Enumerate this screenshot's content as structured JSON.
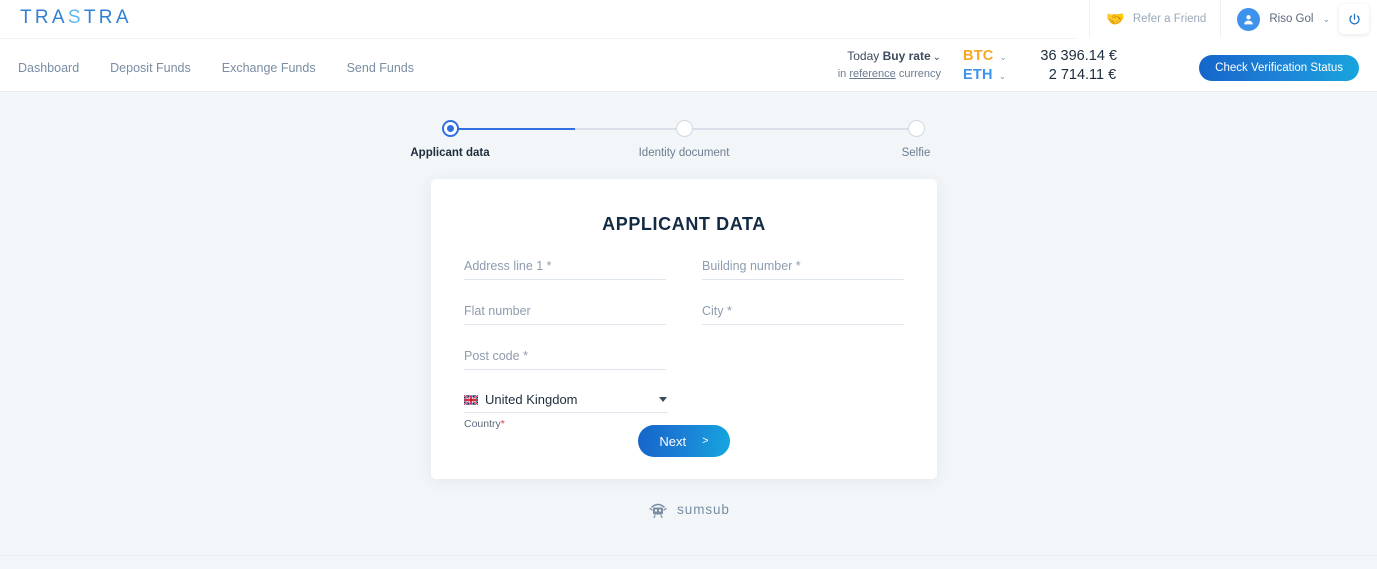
{
  "brand": {
    "name_part1": "TRA",
    "name_accent": "S",
    "name_part2": "TRA"
  },
  "nav": {
    "items": [
      {
        "label": "Dashboard"
      },
      {
        "label": "Deposit Funds"
      },
      {
        "label": "Exchange Funds"
      },
      {
        "label": "Send Funds"
      }
    ]
  },
  "header": {
    "refer_label": "Refer a Friend",
    "refer_icon": "handshake-icon",
    "username": "Riso Gol",
    "user_caret": "⌄",
    "avatar_icon": "user-avatar-icon",
    "power_icon": "power-icon"
  },
  "rates": {
    "today_prefix": "Today",
    "today_bold": "Buy rate",
    "today_caret": "⌄",
    "reference_prefix": "in",
    "reference_link": "reference",
    "reference_suffix": "currency",
    "rows": [
      {
        "ticker": "BTC",
        "ticker_color": "#f5a623",
        "caret": "⌄",
        "value": "36 396.14 €"
      },
      {
        "ticker": "ETH",
        "ticker_color": "#3d93ec",
        "caret": "⌄",
        "value": "2 714.11 €"
      }
    ]
  },
  "verification": {
    "button_label": "Check Verification Status"
  },
  "stepper": {
    "steps": [
      {
        "label": "Applicant data",
        "state": "active"
      },
      {
        "label": "Identity document",
        "state": "pending"
      },
      {
        "label": "Selfie",
        "state": "pending"
      }
    ]
  },
  "form": {
    "title": "APPLICANT DATA",
    "fields": [
      {
        "name": "address-line-1",
        "placeholder": "Address line 1 *",
        "value": ""
      },
      {
        "name": "building-number",
        "placeholder": "Building number *",
        "value": ""
      },
      {
        "name": "flat-number",
        "placeholder": "Flat number",
        "value": ""
      },
      {
        "name": "city",
        "placeholder": "City *",
        "value": ""
      },
      {
        "name": "post-code",
        "placeholder": "Post code *",
        "value": ""
      }
    ],
    "country": {
      "selected": "United Kingdom",
      "flag_icon": "uk-flag-icon",
      "caret_icon": "chevron-down-icon",
      "sub_label": "Country",
      "required_mark": "*"
    },
    "next_label": "Next",
    "next_chevron": ">"
  },
  "footer": {
    "provider_icon": "sumsub-mascot-icon",
    "provider_name": "sumsub"
  },
  "colors": {
    "page_bg": "#f2f6f9",
    "brand_blue": "#2f7fd4",
    "brand_light_blue": "#5fb8ef",
    "accent_gradient_start": "#1565c9",
    "accent_gradient_end": "#16a7df",
    "step_active": "#2f6fe0",
    "required_red": "#e8384f",
    "btc_orange": "#f5a623",
    "eth_blue": "#3d93ec"
  }
}
